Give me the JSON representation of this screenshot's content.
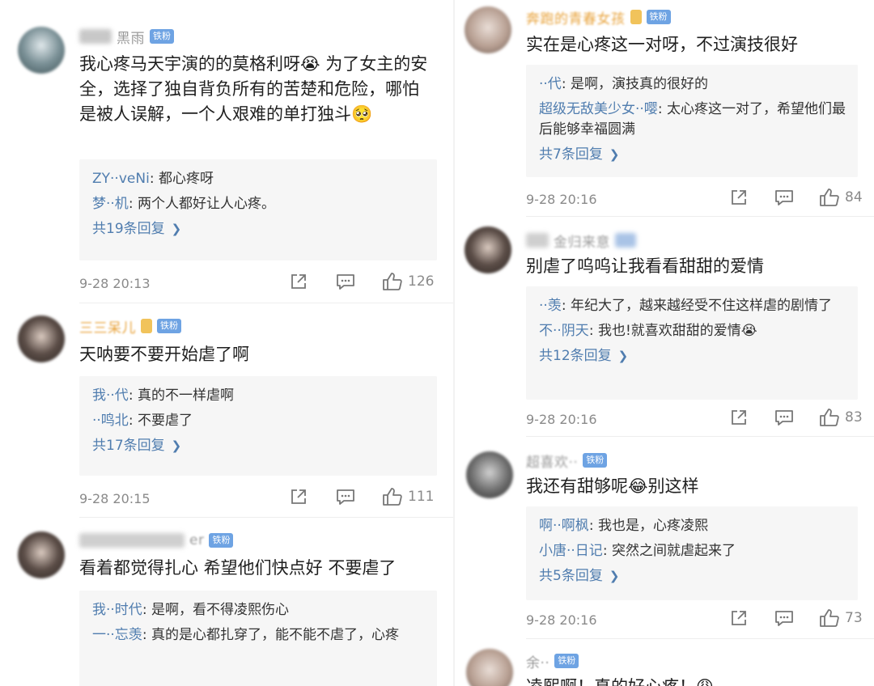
{
  "left": {
    "comments": [
      {
        "username_visible": "黑雨",
        "badge": "铁粉",
        "text": "我心疼马天宇演的的莫格利呀😭 为了女主的安全，选择了独自背负所有的苦楚和危险，哪怕是被人误解，一个人艰难的单打独斗🥺",
        "replies": [
          {
            "name": "ZY··veNi",
            "text": ": 都心疼呀"
          },
          {
            "name": "梦··机",
            "text": ": 两个人都好让人心疼。"
          }
        ],
        "more": "共19条回复",
        "time": "9-28 20:13",
        "likes": "126"
      },
      {
        "username_visible": "三三呆儿",
        "badge": "铁粉",
        "text": "天呐要不要开始虐了啊",
        "replies": [
          {
            "name": "我··代",
            "text": ": 真的不一样虐啊"
          },
          {
            "name": "··鸣北",
            "text": ": 不要虐了"
          }
        ],
        "more": "共17条回复",
        "time": "9-28 20:15",
        "likes": "111"
      },
      {
        "username_visible": "er",
        "badge": "铁粉",
        "text": "看着都觉得扎心 希望他们快点好 不要虐了",
        "replies": [
          {
            "name": "我··时代",
            "text": ": 是啊，看不得凌熙伤心"
          },
          {
            "name": "一··忘羡",
            "text": ": 真的是心都扎穿了，能不能不虐了，心疼"
          }
        ]
      }
    ]
  },
  "right": {
    "comments": [
      {
        "username_visible": "奔跑的青春女孩",
        "badge": "铁粉",
        "text": "实在是心疼这一对呀，不过演技很好",
        "replies": [
          {
            "name": "··代",
            "text": ": 是啊，演技真的很好的"
          },
          {
            "name": "超级无敌美少女··嘤",
            "text": ": 太心疼这一对了，希望他们最后能够幸福圆满"
          }
        ],
        "more": "共7条回复",
        "time": "9-28 20:16",
        "likes": "84"
      },
      {
        "username_visible": "金归来意",
        "badge": "",
        "text": "别虐了呜呜让我看看甜甜的爱情",
        "replies": [
          {
            "name": "··羡",
            "text": ": 年纪大了，越来越经受不住这样虐的剧情了"
          },
          {
            "name": "不··阴天",
            "text": ": 我也!就喜欢甜甜的爱情😭"
          }
        ],
        "more": "共12条回复",
        "time": "9-28 20:16",
        "likes": "83"
      },
      {
        "username_visible": "超喜欢··",
        "badge": "铁粉",
        "text": "我还有甜够呢😂别这样",
        "replies": [
          {
            "name": "啊··啊枫",
            "text": ": 我也是，心疼凌熙"
          },
          {
            "name": "小唐··日记",
            "text": ": 突然之间就虐起来了"
          }
        ],
        "more": "共5条回复",
        "time": "9-28 20:16",
        "likes": "73"
      },
      {
        "username_visible": "余··",
        "badge": "铁粉",
        "text": "凌熙啊！真的好心疼！😩"
      }
    ]
  },
  "colors": {
    "reply_name": "#507daf",
    "badge_bg": "#6ea3e3",
    "reply_bg": "#f6f6f6",
    "meta_gray": "#8a8a8a"
  },
  "icons": [
    "share-icon",
    "comment-icon",
    "like-icon"
  ]
}
